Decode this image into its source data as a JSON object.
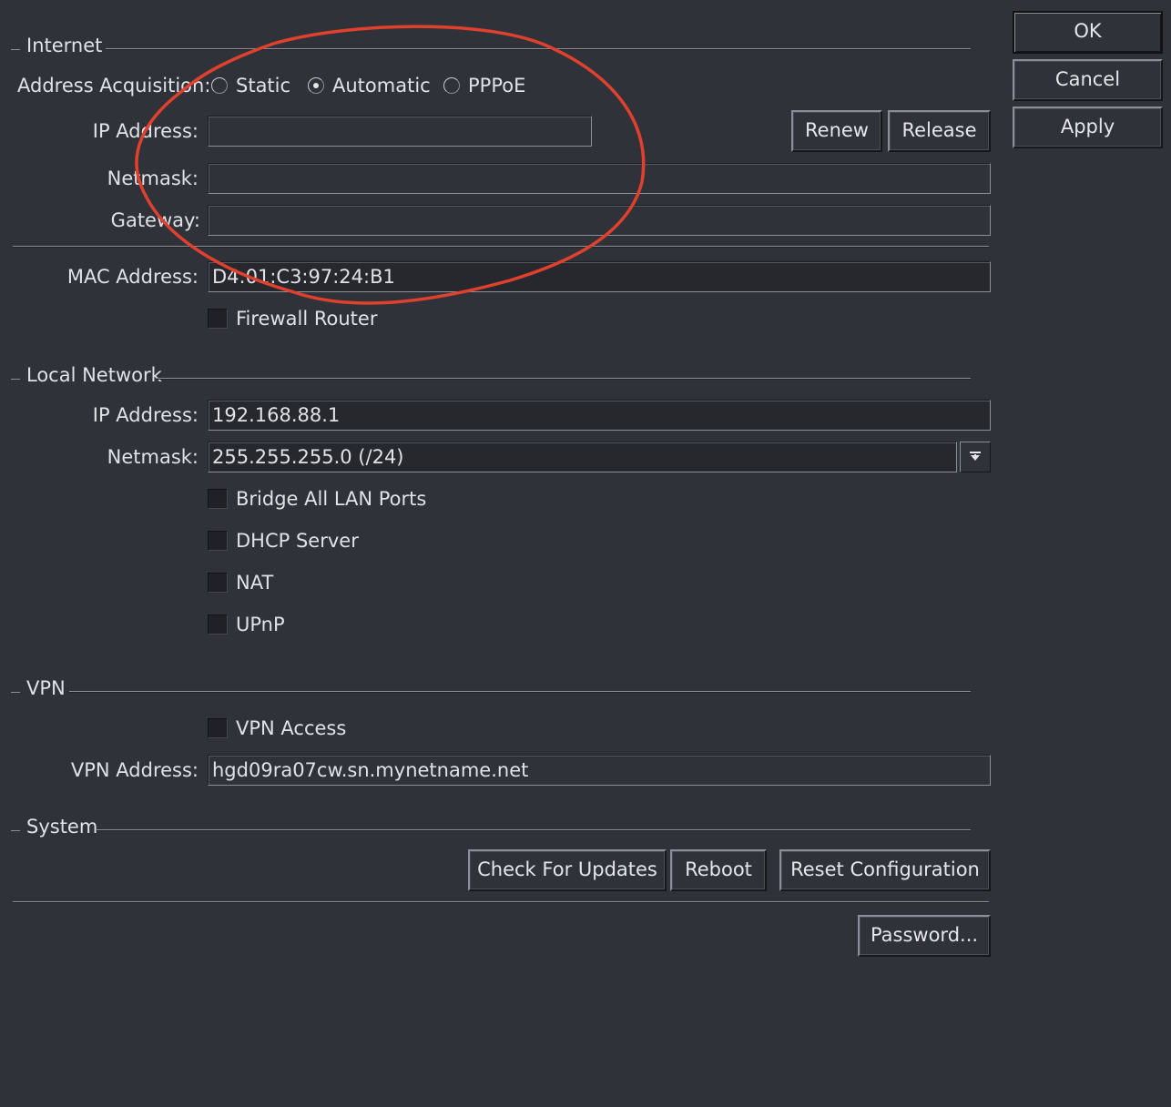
{
  "dialog": {
    "ok_label": "OK",
    "cancel_label": "Cancel",
    "apply_label": "Apply"
  },
  "internet": {
    "title": "Internet",
    "acquisition_label": "Address Acquisition:",
    "options": [
      "Static",
      "Automatic",
      "PPPoE"
    ],
    "selected": "Automatic",
    "ip_label": "IP Address:",
    "ip_value": "",
    "renew_label": "Renew",
    "release_label": "Release",
    "netmask_label": "Netmask:",
    "netmask_value": "",
    "gateway_label": "Gateway:",
    "gateway_value": "",
    "mac_label": "MAC Address:",
    "mac_value": "D4:01:C3:97:24:B1",
    "firewall_label": "Firewall Router",
    "firewall_checked": false
  },
  "local": {
    "title": "Local Network",
    "ip_label": "IP Address:",
    "ip_value": "192.168.88.1",
    "netmask_label": "Netmask:",
    "netmask_value": "255.255.255.0 (/24)",
    "bridge_label": "Bridge All LAN Ports",
    "dhcp_label": "DHCP Server",
    "nat_label": "NAT",
    "upnp_label": "UPnP"
  },
  "vpn": {
    "title": "VPN",
    "access_label": "VPN Access",
    "address_label": "VPN Address:",
    "address_value": "hgd09ra07cw.sn.mynetname.net"
  },
  "system": {
    "title": "System",
    "check_updates_label": "Check For Updates",
    "reboot_label": "Reboot",
    "reset_label": "Reset Configuration",
    "password_label": "Password..."
  },
  "colors": {
    "background": "#2f3238",
    "annotation": "#e0402e"
  }
}
